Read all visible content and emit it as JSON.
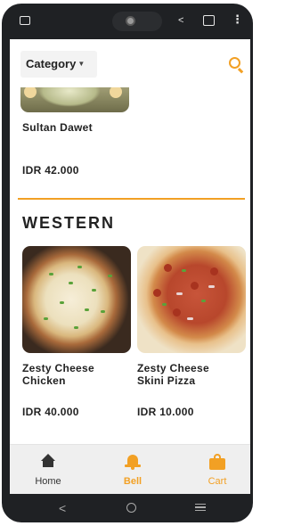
{
  "header": {
    "category_label": "Category",
    "category_chevron": "chevron-down-icon",
    "search_icon": "search-icon"
  },
  "colors": {
    "accent": "#f2a024",
    "text": "#222222",
    "tabbar_bg": "#efefef"
  },
  "top_item": {
    "name": "Sultan Dawet",
    "price": "IDR 42.000"
  },
  "section": {
    "title": "WESTERN",
    "items": [
      {
        "name_line1": "Zesty Cheese",
        "name_line2": "Chicken",
        "price": "IDR 40.000"
      },
      {
        "name_line1": "Zesty Cheese",
        "name_line2": "Skini Pizza",
        "price": "IDR 10.000"
      }
    ]
  },
  "tabbar": {
    "tabs": [
      {
        "label": "Home",
        "icon": "home-icon",
        "color": "#333333"
      },
      {
        "label": "Bell",
        "icon": "bell-icon",
        "color": "#f2a024"
      },
      {
        "label": "Cart",
        "icon": "bag-icon",
        "color": "#f2a024"
      }
    ]
  },
  "system_nav": {
    "back_glyph": "<"
  }
}
